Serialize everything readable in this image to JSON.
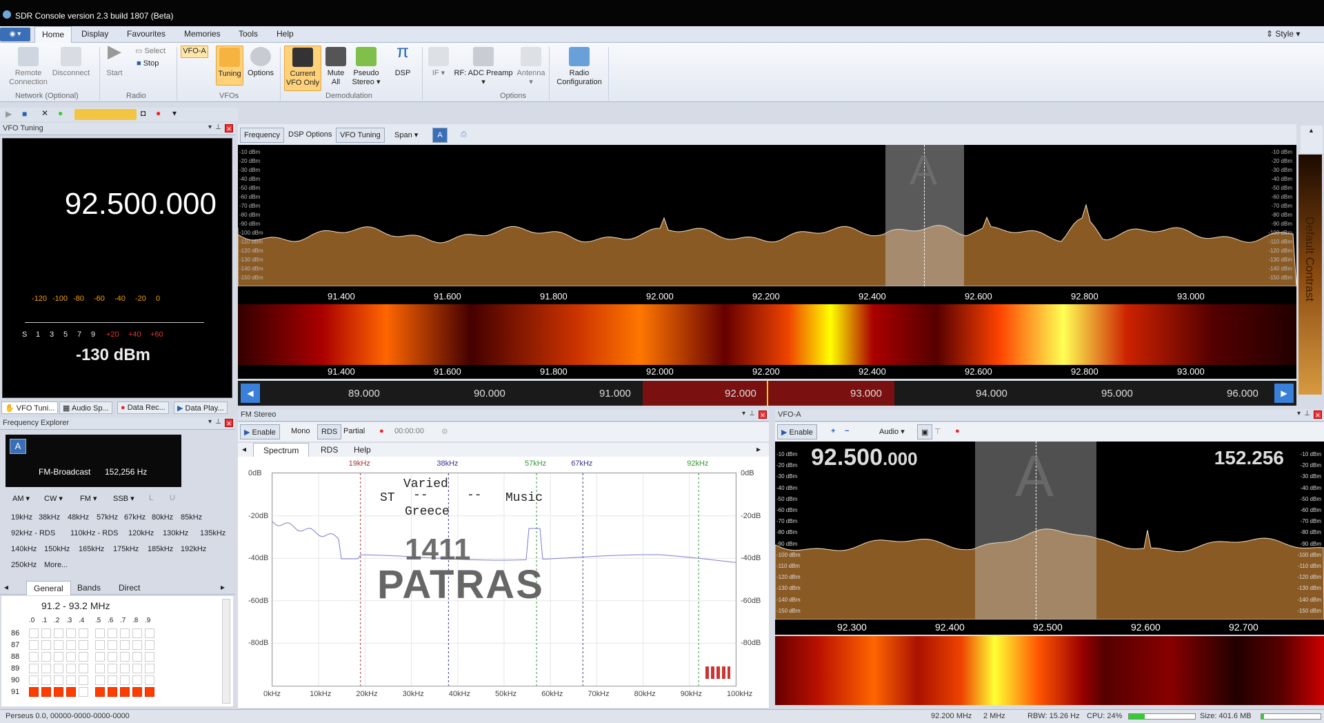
{
  "window": {
    "title": "SDR Console version 2.3 build 1807 (Beta)"
  },
  "ribbon": {
    "tabs": [
      "Home",
      "Display",
      "Favourites",
      "Memories",
      "Tools",
      "Help"
    ],
    "style_label": "Style",
    "remote_connection": "Remote Connection",
    "disconnect": "Disconnect",
    "network_group": "Network (Optional)",
    "start": "Start",
    "select": "Select",
    "stop": "Stop",
    "radio_group": "Radio",
    "vfo_a": "VFO-A",
    "tuning": "Tuning",
    "options": "Options",
    "vfos_group": "VFOs",
    "current_vfo_only": "Current VFO Only",
    "mute_all": "Mute All",
    "pseudo_stereo": "Pseudo Stereo",
    "dsp": "DSP",
    "demod_group": "Demodulation",
    "if": "IF",
    "rf_adc": "RF: ADC Preamp",
    "antenna": "Antenna",
    "options_group": "Options",
    "radio_config": "Radio Configuration"
  },
  "vfo_tuning": {
    "title": "VFO Tuning",
    "frequency": "92.500.000",
    "scale_top": [
      "-120",
      "-100",
      "-80",
      "-60",
      "-40",
      "-20",
      "0"
    ],
    "scale_s": [
      "S",
      "1",
      "3",
      "5",
      "7",
      "9"
    ],
    "scale_plus": [
      "+20",
      "+40",
      "+60"
    ],
    "level": "-130 dBm"
  },
  "bottom_tabs": [
    "VFO Tuni...",
    "Audio Sp...",
    "Data Rec...",
    "Data Play..."
  ],
  "freq_explorer": {
    "title": "Frequency Explorer",
    "badge": "A",
    "name": "FM-Broadcast",
    "bw": "152,256 Hz",
    "modes": [
      "AM",
      "CW",
      "FM",
      "SSB",
      "L",
      "U"
    ],
    "links": [
      "19kHz",
      "38kHz",
      "48kHz",
      "57kHz",
      "67kHz",
      "80kHz",
      "85kHz",
      "92kHz - RDS",
      "110kHz - RDS",
      "120kHz",
      "130kHz",
      "135kHz",
      "140kHz",
      "150kHz",
      "165kHz",
      "175kHz",
      "185kHz",
      "192kHz",
      "250kHz",
      "More..."
    ],
    "tabs": [
      "General",
      "Bands",
      "Direct"
    ],
    "range": "91.2 - 93.2 MHz",
    "cols": [
      ".0",
      ".1",
      ".2",
      ".3",
      ".4",
      ".5",
      ".6",
      ".7",
      ".8",
      ".9"
    ],
    "rows": [
      "86",
      "87",
      "88",
      "89",
      "90",
      "91"
    ]
  },
  "spectrum": {
    "toolbar": [
      "Frequency",
      "DSP Options",
      "VFO Tuning",
      "Span"
    ],
    "vfo_marker": "A",
    "db_labels": [
      "-10 dBm",
      "-20 dBm",
      "-30 dBm",
      "-40 dBm",
      "-50 dBm",
      "-60 dBm",
      "-70 dBm",
      "-80 dBm",
      "-90 dBm",
      "-100 dBm",
      "-110 dBm",
      "-120 dBm",
      "-130 dBm",
      "-140 dBm",
      "-150 dBm"
    ],
    "axis": [
      "91.400",
      "91.600",
      "91.800",
      "92.000",
      "92.200",
      "92.400",
      "92.600",
      "92.800",
      "93.000"
    ],
    "band_axis": [
      "89.000",
      "90.000",
      "91.000",
      "92.000",
      "93.000",
      "94.000",
      "95.000",
      "96.000"
    ],
    "contrast": "Default Contrast"
  },
  "fm_stereo": {
    "title": "FM Stereo",
    "enable": "Enable",
    "mono": "Mono",
    "rds": "RDS",
    "partial": "Partial",
    "time": "00:00:00",
    "tabs": [
      "Spectrum",
      "RDS",
      "Help"
    ],
    "markers": [
      "19kHz",
      "38kHz",
      "57kHz",
      "67kHz",
      "92kHz"
    ],
    "y_labels": [
      "0dB",
      "-20dB",
      "-40dB",
      "-60dB",
      "-80dB"
    ],
    "x_labels": [
      "0kHz",
      "10kHz",
      "20kHz",
      "30kHz",
      "40kHz",
      "50kHz",
      "60kHz",
      "70kHz",
      "80kHz",
      "90kHz",
      "100kHz"
    ],
    "rds_st": "ST",
    "rds_varied": "Varied",
    "rds_dash1": "--",
    "rds_dash2": "--",
    "rds_music": "Music",
    "rds_greece": "Greece",
    "rds_pi": "1411",
    "rds_ps": "PATRAS"
  },
  "vfo_a": {
    "title": "VFO-A",
    "enable": "Enable",
    "audio": "Audio",
    "freq_main": "92.500",
    "freq_small": ".000",
    "bandwidth": "152.256",
    "marker": "A",
    "db_labels": [
      "-10 dBm",
      "-20 dBm",
      "-30 dBm",
      "-40 dBm",
      "-50 dBm",
      "-60 dBm",
      "-70 dBm",
      "-80 dBm",
      "-90 dBm",
      "-100 dBm",
      "-110 dBm",
      "-120 dBm",
      "-130 dBm",
      "-140 dBm",
      "-150 dBm"
    ],
    "axis": [
      "92.300",
      "92.400",
      "92.500",
      "92.600",
      "92.700"
    ]
  },
  "status": {
    "device": "Perseus 0.0, 00000-0000-0000-0000",
    "freq": "92.200 MHz",
    "span": "2 MHz",
    "rbw": "RBW: 15.26 Hz",
    "cpu": "CPU: 24%",
    "size": "Size: 401.6 MB",
    "cpu_fraction": 0.24,
    "size_fraction": 0.05
  }
}
